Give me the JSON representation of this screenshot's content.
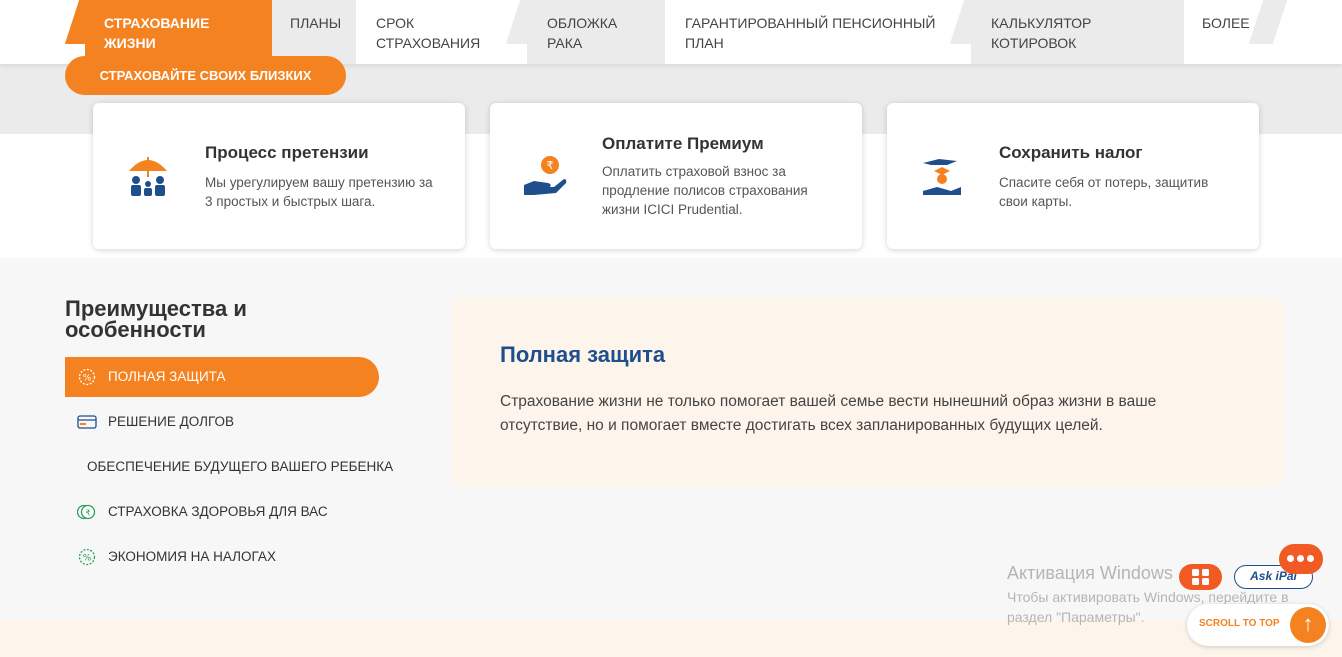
{
  "nav": {
    "tabs": [
      {
        "line1": "СТРАХОВАНИЕ",
        "line2": "ЖИЗНИ"
      },
      {
        "line1": "ПЛАНЫ",
        "line2": ""
      },
      {
        "line1": "СРОК",
        "line2": "СТРАХОВАНИЯ"
      },
      {
        "line1": "ОБЛОЖКА",
        "line2": "РАКА"
      },
      {
        "line1": "ГАРАНТИРОВАННЫЙ ПЕНСИОННЫЙ",
        "line2": "ПЛАН"
      },
      {
        "line1": "КАЛЬКУЛЯТОР",
        "line2": "КОТИРОВОК"
      },
      {
        "line1": "БОЛЕЕ",
        "line2": ""
      }
    ]
  },
  "hero": {
    "cta_label": "СТРАХОВАЙТЕ СВОИХ БЛИЗКИХ"
  },
  "cards": [
    {
      "title": "Процесс претензии",
      "desc": "Мы урегулируем вашу претензию за 3 простых и быстрых шага.",
      "icon": "umbrella-family-icon"
    },
    {
      "title": "Оплатите Премиум",
      "desc": "Оплатить страховой взнос за продление полисов страхования жизни ICICI Prudential.",
      "icon": "rupee-coin-hand-icon"
    },
    {
      "title": "Сохранить налог",
      "desc": "Спасите себя от потерь, защитив свои карты.",
      "icon": "graduate-hands-icon"
    }
  ],
  "features": {
    "title": "Преимущества и особенности",
    "items": [
      {
        "label": "ПОЛНАЯ ЗАЩИТА",
        "icon": "percent-badge-icon"
      },
      {
        "label": "РЕШЕНИЕ ДОЛГОВ",
        "icon": "credit-card-icon"
      },
      {
        "label": "ОБЕСПЕЧЕНИЕ БУДУЩЕГО ВАШЕГО РЕБЕНКА",
        "icon": ""
      },
      {
        "label": "СТРАХОВКА ЗДОРОВЬЯ ДЛЯ ВАС",
        "icon": "rupee-coins-icon"
      },
      {
        "label": "ЭКОНОМИЯ НА НАЛОГАХ",
        "icon": "percent-badge-icon"
      }
    ],
    "panel": {
      "title": "Полная защита",
      "desc": "Страхование жизни не только помогает вашей семье вести нынешний образ жизни в ваше отсутствие, но и помогает вместе достигать всех запланированных будущих целей."
    }
  },
  "watermark": {
    "line1": "Активация Windows",
    "line2": "Чтобы активировать Windows, перейдите в раздел \"Параметры\"."
  },
  "widgets": {
    "askipal_label": "Ask iPal",
    "scroll_top_label": "SCROLL TO TOP",
    "scroll_top_arrow": "↑"
  },
  "colors": {
    "accent": "#f58220",
    "navy": "#1f4e8c",
    "light_bg": "#fdf5eb"
  }
}
